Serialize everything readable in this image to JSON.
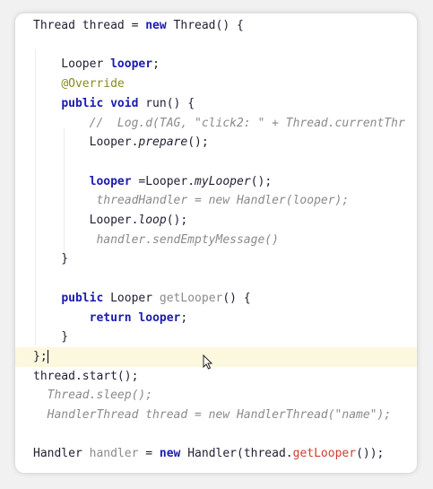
{
  "editor": {
    "lines": [
      {
        "parts": [
          {
            "t": "Thread thread = "
          },
          {
            "t": "new",
            "c": "kw"
          },
          {
            "t": " Thread() {"
          }
        ]
      },
      {
        "parts": []
      },
      {
        "parts": [
          {
            "t": "    Looper "
          },
          {
            "t": "looper",
            "c": "fld"
          },
          {
            "t": ";"
          }
        ]
      },
      {
        "parts": [
          {
            "t": "    "
          },
          {
            "t": "@Override",
            "c": "ann"
          }
        ]
      },
      {
        "parts": [
          {
            "t": "    "
          },
          {
            "t": "public void",
            "c": "kw"
          },
          {
            "t": " run() {"
          }
        ]
      },
      {
        "parts": [
          {
            "t": "        //  Log.d(TAG, \"click2: \" + Thread.currentThr",
            "c": "cm"
          }
        ]
      },
      {
        "parts": [
          {
            "t": "        Looper."
          },
          {
            "t": "prepare",
            "c": "it"
          },
          {
            "t": "();"
          }
        ]
      },
      {
        "parts": []
      },
      {
        "parts": [
          {
            "t": "        "
          },
          {
            "t": "looper",
            "c": "fld"
          },
          {
            "t": " =Looper."
          },
          {
            "t": "myLooper",
            "c": "it"
          },
          {
            "t": "();"
          }
        ]
      },
      {
        "parts": [
          {
            "t": "         threadHandler = new Handler(looper);",
            "c": "mu"
          }
        ]
      },
      {
        "parts": [
          {
            "t": "        Looper."
          },
          {
            "t": "loop",
            "c": "it"
          },
          {
            "t": "();"
          }
        ]
      },
      {
        "parts": [
          {
            "t": "         handler.sendEmptyMessage()",
            "c": "mu"
          }
        ]
      },
      {
        "parts": [
          {
            "t": "    }"
          }
        ]
      },
      {
        "parts": []
      },
      {
        "parts": [
          {
            "t": "    "
          },
          {
            "t": "public",
            "c": "kw"
          },
          {
            "t": " Looper "
          },
          {
            "t": "getLooper",
            "c": "unused"
          },
          {
            "t": "() {"
          }
        ]
      },
      {
        "parts": [
          {
            "t": "        "
          },
          {
            "t": "return",
            "c": "kw"
          },
          {
            "t": " "
          },
          {
            "t": "looper",
            "c": "fld"
          },
          {
            "t": ";"
          }
        ]
      },
      {
        "parts": [
          {
            "t": "    }"
          }
        ]
      },
      {
        "hl": true,
        "caret": true,
        "parts": [
          {
            "t": "};"
          }
        ]
      },
      {
        "parts": [
          {
            "t": "thread.start();"
          }
        ]
      },
      {
        "parts": [
          {
            "t": "  Thread.sleep();",
            "c": "mu"
          }
        ]
      },
      {
        "parts": [
          {
            "t": "  HandlerThread thread = new HandlerThread(\"name\");",
            "c": "mu"
          }
        ]
      },
      {
        "parts": []
      },
      {
        "parts": [
          {
            "t": "Handler "
          },
          {
            "t": "handler",
            "c": "unused"
          },
          {
            "t": " = "
          },
          {
            "t": "new",
            "c": "kw"
          },
          {
            "t": " Handler(thread."
          },
          {
            "t": "getLooper",
            "c": "red"
          },
          {
            "t": "());"
          }
        ]
      }
    ]
  }
}
